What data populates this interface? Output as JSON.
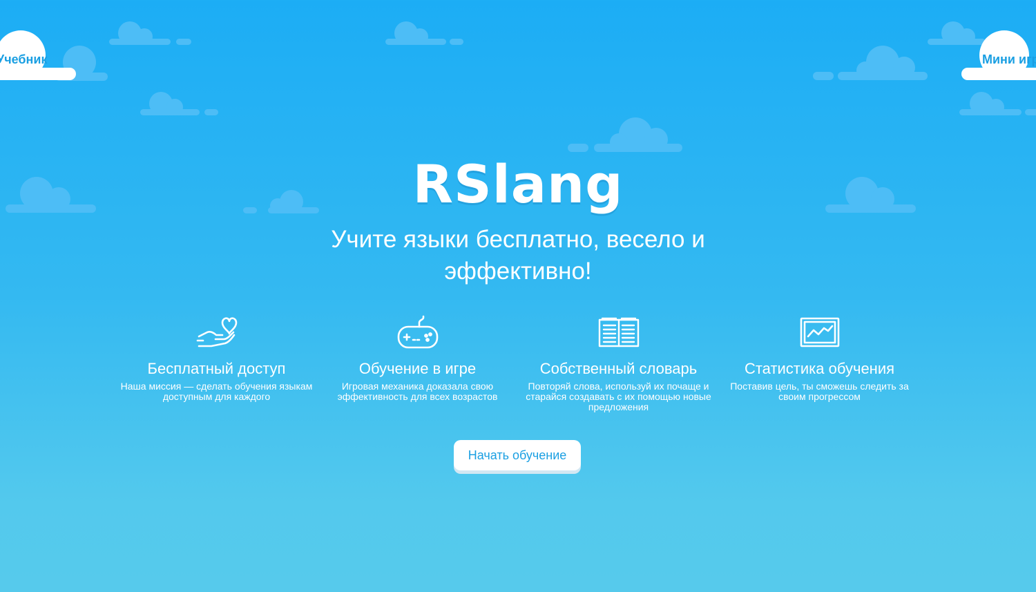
{
  "nav": {
    "textbook_label": "Учебник",
    "minigames_label": "Мини игры"
  },
  "hero": {
    "logo": "RSlang",
    "tagline": "Учите языки бесплатно, весело и эффективно!"
  },
  "features": [
    {
      "icon": "heart-hand-icon",
      "title": "Бесплатный доступ",
      "description": "Наша миссия — сделать обучения языкам доступным для каждого"
    },
    {
      "icon": "gamepad-icon",
      "title": "Обучение в игре",
      "description": "Игровая механика доказала свою эффективность для всех возрастов"
    },
    {
      "icon": "open-book-icon",
      "title": "Собственный словарь",
      "description": "Повторяй слова, используй их почаще и старайся создавать с их помощью новые предложения"
    },
    {
      "icon": "chart-icon",
      "title": "Статистика обучения",
      "description": "Поставив цель, ты сможешь следить за своим прогрессом"
    }
  ],
  "cta": {
    "start_label": "Начать обучение"
  },
  "colors": {
    "background_top": "#1cadf5",
    "background_bottom": "#56caec",
    "decor_cloud": "#4dbdf6",
    "nav_cloud": "#ffffff",
    "accent_text": "#1a9fe2"
  }
}
